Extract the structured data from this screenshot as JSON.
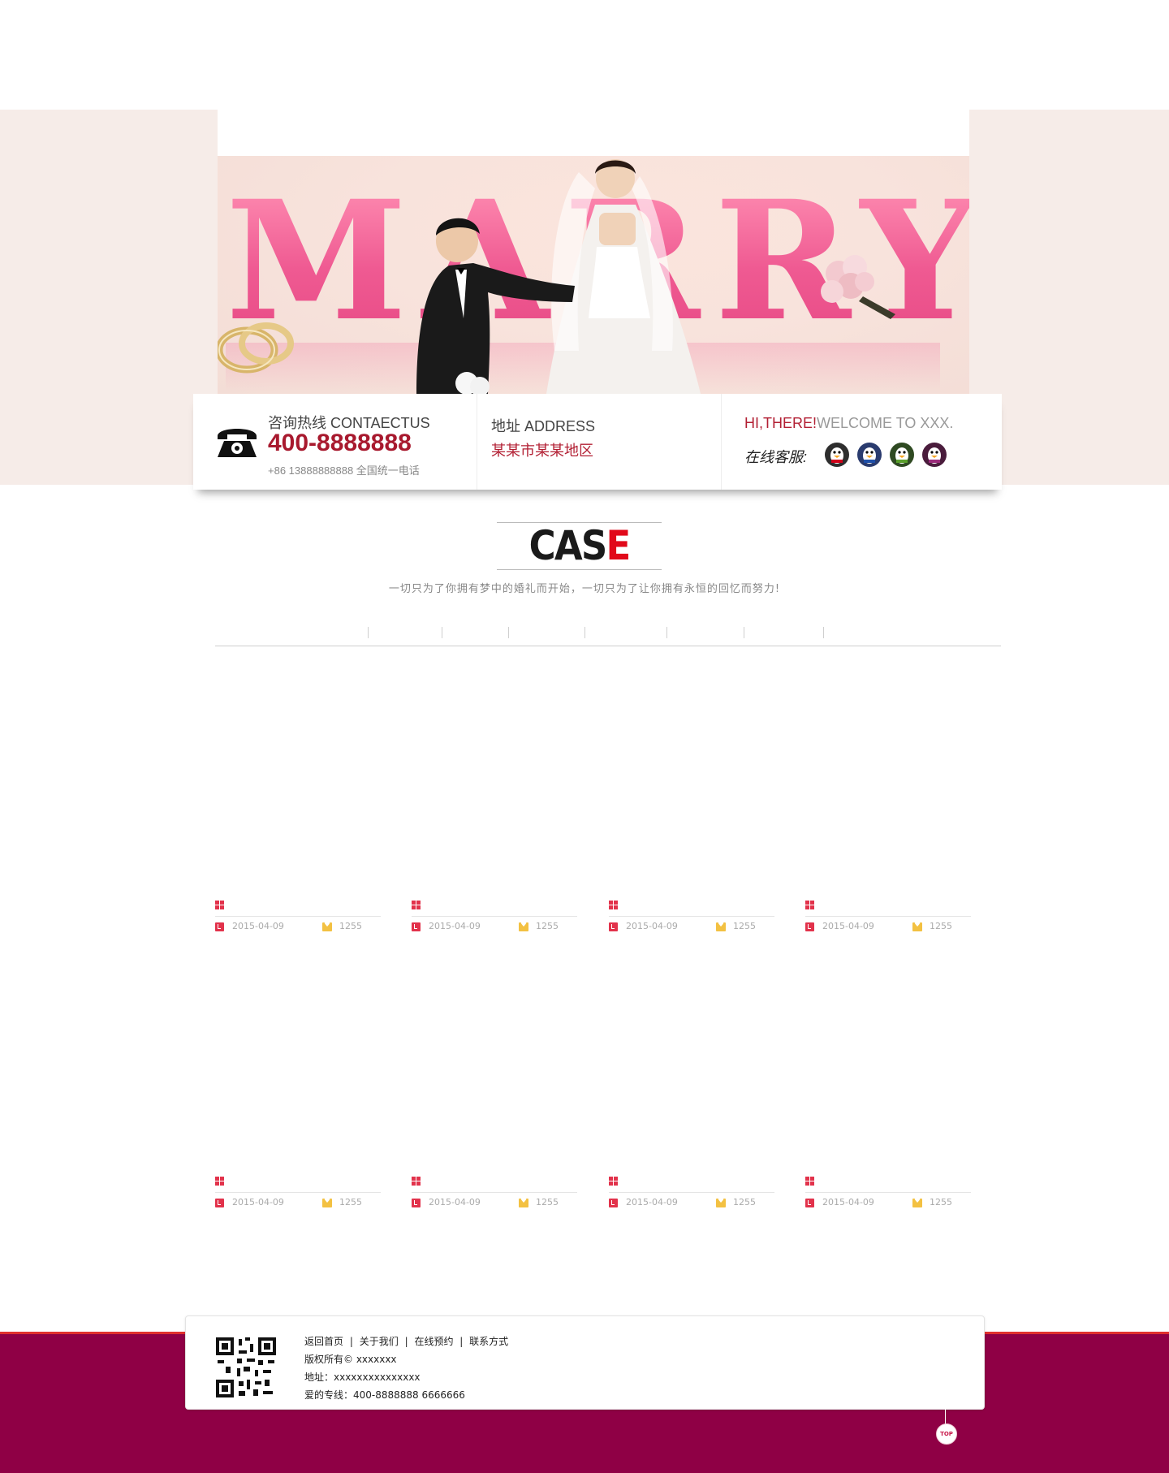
{
  "colors": {
    "accent_red": "#a8192e",
    "case_red": "#e1091a",
    "footer_band": "#8f0045",
    "footer_stripe": "#e0302e",
    "hero_bg": "#f6ece8",
    "marry_pink": "#f06b9b"
  },
  "hero": {
    "word": "MARRY"
  },
  "info_bar": {
    "phone": {
      "icon": "telephone-icon",
      "label": "咨询热线 CONTAECTUS",
      "number": "400-8888888",
      "sub": "+86 13888888888 全国统一电话"
    },
    "address": {
      "label": "地址 ADDRESS",
      "value": "某某市某某地区"
    },
    "service": {
      "greeting_hi": "HI,THERE!",
      "greeting_welcome": "WELCOME TO XXX.",
      "label": "在线客服:",
      "agents": [
        "qq-icon",
        "qq-icon",
        "qq-icon",
        "qq-icon"
      ]
    }
  },
  "case_section": {
    "title_main": "CAS",
    "title_accent": "E",
    "subtitle": "一切只为了你拥有梦中的婚礼而开始，一切只为了让你拥有永恒的回忆而努力!"
  },
  "cases": [
    {
      "date": "2015-04-09",
      "count": "1255"
    },
    {
      "date": "2015-04-09",
      "count": "1255"
    },
    {
      "date": "2015-04-09",
      "count": "1255"
    },
    {
      "date": "2015-04-09",
      "count": "1255"
    },
    {
      "date": "2015-04-09",
      "count": "1255"
    },
    {
      "date": "2015-04-09",
      "count": "1255"
    },
    {
      "date": "2015-04-09",
      "count": "1255"
    },
    {
      "date": "2015-04-09",
      "count": "1255"
    }
  ],
  "footer": {
    "links": [
      "返回首页",
      "关于我们",
      "在线预约",
      "联系方式"
    ],
    "separator": "|",
    "copyright": "版权所有©   xxxxxxx",
    "address": "地址：xxxxxxxxxxxxxxx",
    "hotline": "爱的专线：400-8888888 6666666",
    "top_label": "TOP"
  }
}
